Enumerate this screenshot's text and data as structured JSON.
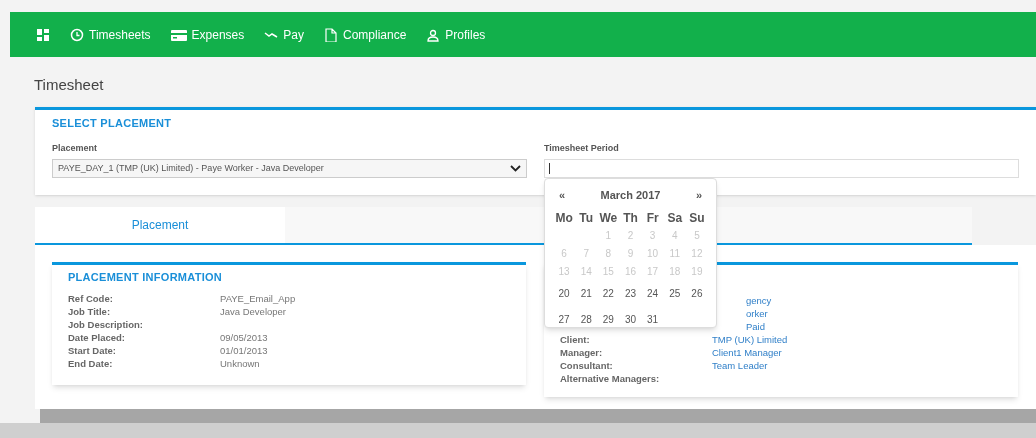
{
  "nav": {
    "items": [
      {
        "kind": "home"
      },
      {
        "kind": "link",
        "label": "Timesheets"
      },
      {
        "kind": "link",
        "label": "Expenses"
      },
      {
        "kind": "link",
        "label": "Pay"
      },
      {
        "kind": "link",
        "label": "Compliance"
      },
      {
        "kind": "link",
        "label": "Profiles"
      }
    ]
  },
  "page_title": "Timesheet",
  "select_placement": {
    "heading": "SELECT PLACEMENT",
    "placement_label": "Placement",
    "placement_value": "PAYE_DAY_1 (TMP (UK) Limited) - Paye Worker - Java Developer",
    "period_label": "Timesheet Period"
  },
  "calendar": {
    "prev": "«",
    "month": "March 2017",
    "next": "»",
    "weekdays": [
      "Mo",
      "Tu",
      "We",
      "Th",
      "Fr",
      "Sa",
      "Su"
    ],
    "weeks": [
      [
        {
          "kind": "blank"
        },
        {
          "kind": "blank"
        },
        {
          "kind": "day",
          "label": "1",
          "disabled": true
        },
        {
          "kind": "day",
          "label": "2",
          "disabled": true
        },
        {
          "kind": "day",
          "label": "3",
          "disabled": true
        },
        {
          "kind": "day",
          "label": "4",
          "disabled": true
        },
        {
          "kind": "day",
          "label": "5",
          "disabled": true
        }
      ],
      [
        {
          "kind": "day",
          "label": "6",
          "disabled": true
        },
        {
          "kind": "day",
          "label": "7",
          "disabled": true
        },
        {
          "kind": "day",
          "label": "8",
          "disabled": true
        },
        {
          "kind": "day",
          "label": "9",
          "disabled": true
        },
        {
          "kind": "day",
          "label": "10",
          "disabled": true
        },
        {
          "kind": "day",
          "label": "11",
          "disabled": true
        },
        {
          "kind": "day",
          "label": "12",
          "disabled": true
        }
      ],
      [
        {
          "kind": "day",
          "label": "13",
          "disabled": true
        },
        {
          "kind": "day",
          "label": "14",
          "disabled": true
        },
        {
          "kind": "day",
          "label": "15",
          "disabled": true
        },
        {
          "kind": "day",
          "label": "16",
          "disabled": true
        },
        {
          "kind": "day",
          "label": "17",
          "disabled": true
        },
        {
          "kind": "day",
          "label": "18",
          "disabled": true
        },
        {
          "kind": "day",
          "label": "19",
          "disabled": true
        }
      ],
      [
        {
          "kind": "day",
          "label": "20",
          "disabled": false
        },
        {
          "kind": "day",
          "label": "21",
          "disabled": false
        },
        {
          "kind": "day",
          "label": "22",
          "disabled": false
        },
        {
          "kind": "day",
          "label": "23",
          "disabled": false
        },
        {
          "kind": "day",
          "label": "24",
          "disabled": false
        },
        {
          "kind": "day",
          "label": "25",
          "disabled": false
        },
        {
          "kind": "day",
          "label": "26",
          "disabled": false
        }
      ],
      [
        {
          "kind": "day",
          "label": "27",
          "disabled": false
        },
        {
          "kind": "day",
          "label": "28",
          "disabled": false
        },
        {
          "kind": "day",
          "label": "29",
          "disabled": false
        },
        {
          "kind": "day",
          "label": "30",
          "disabled": false
        },
        {
          "kind": "day",
          "label": "31",
          "disabled": false
        },
        {
          "kind": "blank"
        },
        {
          "kind": "blank"
        }
      ]
    ]
  },
  "tabs": [
    {
      "label": "Placement",
      "selected": true
    }
  ],
  "placement_information": {
    "heading": "PLACEMENT INFORMATION",
    "rows": [
      {
        "label": "Ref Code:",
        "value": "PAYE_Email_App"
      },
      {
        "label": "Job Title:",
        "value": "Java Developer"
      },
      {
        "label": "Job Description:"
      },
      {
        "label": "Date Placed:",
        "value": "09/05/2013"
      },
      {
        "label": "Start Date:",
        "value": "01/01/2013"
      },
      {
        "label": "End Date:",
        "value": "Unknown"
      }
    ]
  },
  "details": {
    "rows": [
      {
        "value": "gency"
      },
      {
        "value": "orker"
      },
      {
        "value": "Paid"
      },
      {
        "label": "Client:",
        "value": "TMP (UK) Limited"
      },
      {
        "label": "Manager:",
        "value": "Client1 Manager"
      },
      {
        "label": "Consultant:",
        "value": "Team Leader"
      },
      {
        "label": "Alternative Managers:"
      }
    ]
  }
}
